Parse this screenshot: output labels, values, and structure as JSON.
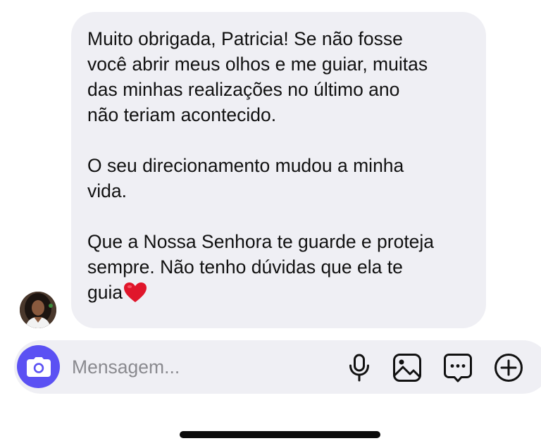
{
  "message": {
    "paragraphs": [
      "Muito obrigada, Patricia! Se não fosse\nvocê abrir meus olhos e me guiar, muitas\ndas minhas realizações no último ano\nnão teriam acontecido.",
      "O seu direcionamento mudou a minha\nvida.",
      "Que a Nossa Senhora te guarde e proteja\nsempre. Não tenho dúvidas que ela te\nguia"
    ],
    "emoji": "heart-emoji"
  },
  "avatar": {
    "icon": "profile-photo"
  },
  "composer": {
    "placeholder": "Mensagem...",
    "camera_icon": "camera-icon",
    "tools": [
      "microphone-icon",
      "image-icon",
      "sticker-icon",
      "plus-circle-icon"
    ]
  },
  "colors": {
    "bubble": "#efeff4",
    "camera_button": "#5b51f3",
    "placeholder": "#8a8a8f",
    "heart": "#e0162b"
  }
}
